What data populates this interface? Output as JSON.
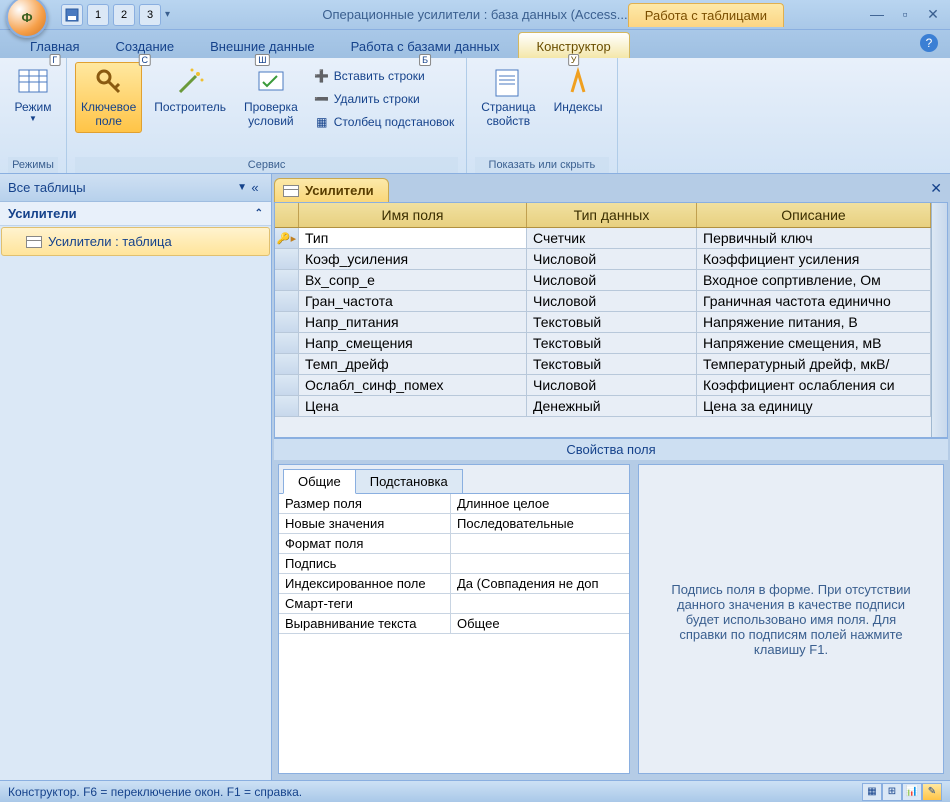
{
  "title": "Операционные усилители : база данных (Access...",
  "context_tab": "Работа с таблицами",
  "qat": {
    "btn1": "1",
    "btn2": "2",
    "btn3": "3",
    "office_badge": "Ф"
  },
  "menu": {
    "items": [
      "Главная",
      "Создание",
      "Внешние данные",
      "Работа с базами данных",
      "Конструктор"
    ],
    "shortcuts": [
      "Г",
      "С",
      "Ш",
      "Б",
      "У"
    ]
  },
  "ribbon": {
    "group_modes": "Режимы",
    "group_service": "Сервис",
    "group_show": "Показать или скрыть",
    "btn_mode": "Режим",
    "btn_key": "Ключевое\nполе",
    "btn_builder": "Построитель",
    "btn_validate": "Проверка\nусловий",
    "btn_insert_rows": "Вставить строки",
    "btn_delete_rows": "Удалить строки",
    "btn_lookup_col": "Столбец  подстановок",
    "btn_prop_sheet": "Страница\nсвойств",
    "btn_indexes": "Индексы"
  },
  "nav": {
    "header": "Все таблицы",
    "group": "Усилители",
    "item": "Усилители : таблица"
  },
  "doc": {
    "tab": "Усилители",
    "columns": {
      "name": "Имя поля",
      "type": "Тип данных",
      "desc": "Описание"
    },
    "rows": [
      {
        "name": "Тип",
        "type": "Счетчик",
        "desc": "Первичный ключ",
        "key": true
      },
      {
        "name": "Коэф_усиления",
        "type": "Числовой",
        "desc": "Коэффициент усиления"
      },
      {
        "name": "Вх_сопр_е",
        "type": "Числовой",
        "desc": "Входное сопртивление, Ом"
      },
      {
        "name": "Гран_частота",
        "type": "Числовой",
        "desc": "Граничная частота единично"
      },
      {
        "name": "Напр_питания",
        "type": "Текстовый",
        "desc": "Напряжение питания,  В"
      },
      {
        "name": "Напр_смещения",
        "type": "Текстовый",
        "desc": "Напряжение смещения, мВ"
      },
      {
        "name": "Темп_дрейф",
        "type": "Текстовый",
        "desc": "Температурный дрейф, мкВ/"
      },
      {
        "name": "Ослабл_синф_помех",
        "type": "Числовой",
        "desc": "Коэффициент ослабления си"
      },
      {
        "name": "Цена",
        "type": "Денежный",
        "desc": "Цена за единицу"
      }
    ],
    "field_props_title": "Свойства поля",
    "tabs": {
      "general": "Общие",
      "lookup": "Подстановка"
    },
    "props": [
      {
        "k": "Размер поля",
        "v": "Длинное целое"
      },
      {
        "k": "Новые значения",
        "v": "Последовательные"
      },
      {
        "k": "Формат поля",
        "v": ""
      },
      {
        "k": "Подпись",
        "v": ""
      },
      {
        "k": "Индексированное поле",
        "v": "Да (Совпадения не доп"
      },
      {
        "k": "Смарт-теги",
        "v": ""
      },
      {
        "k": "Выравнивание текста",
        "v": "Общее"
      }
    ],
    "help_text": "Подпись поля в форме.  При отсутствии данного значения в качестве подписи будет использовано имя поля.  Для справки по подписям полей нажмите клавишу F1."
  },
  "status": "Конструктор.  F6 = переключение окон.  F1 = справка."
}
